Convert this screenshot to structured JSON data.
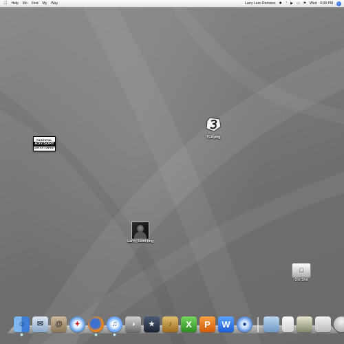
{
  "menubar": {
    "apple_icon": "apple-icon",
    "menus": [
      "Help",
      "Me",
      "Find",
      "My",
      "Way"
    ],
    "user_name": "Larry Luxo Remixes",
    "day": "Wed",
    "time": "6:06 PM",
    "status_icons": [
      "bluetooth-icon",
      "wifi-icon",
      "volume-icon",
      "battery-icon",
      "flag-icon"
    ]
  },
  "desktop": {
    "icons": [
      {
        "kind": "parental-advisory",
        "label": "",
        "advisory_line1": "PARENTAL",
        "advisory_line2": "ADVISORY",
        "advisory_line3": "EXPLICIT CONTENT"
      },
      {
        "kind": "image",
        "label": "TSA.png"
      },
      {
        "kind": "photo",
        "label": "Larry_Luxo.png"
      },
      {
        "kind": "drive",
        "label": "Old Shit"
      }
    ]
  },
  "dock": {
    "apps": [
      "finder-icon",
      "mail-icon",
      "address-book-icon",
      "safari-icon",
      "firefox-icon",
      "itunes-icon",
      "iphoto-icon",
      "imovie-icon",
      "garageband-icon",
      "excel-icon",
      "powerpoint-icon",
      "word-icon",
      "messenger-icon"
    ],
    "right_items": [
      "applications-folder-icon",
      "documents-stack-icon",
      "dashboard-stack-icon",
      "downloads-stack-icon",
      "trash-icon"
    ]
  },
  "colors": {
    "desktop": "#7a7a7a",
    "menubar": "#efefef",
    "spotlight": "#2b63df"
  }
}
